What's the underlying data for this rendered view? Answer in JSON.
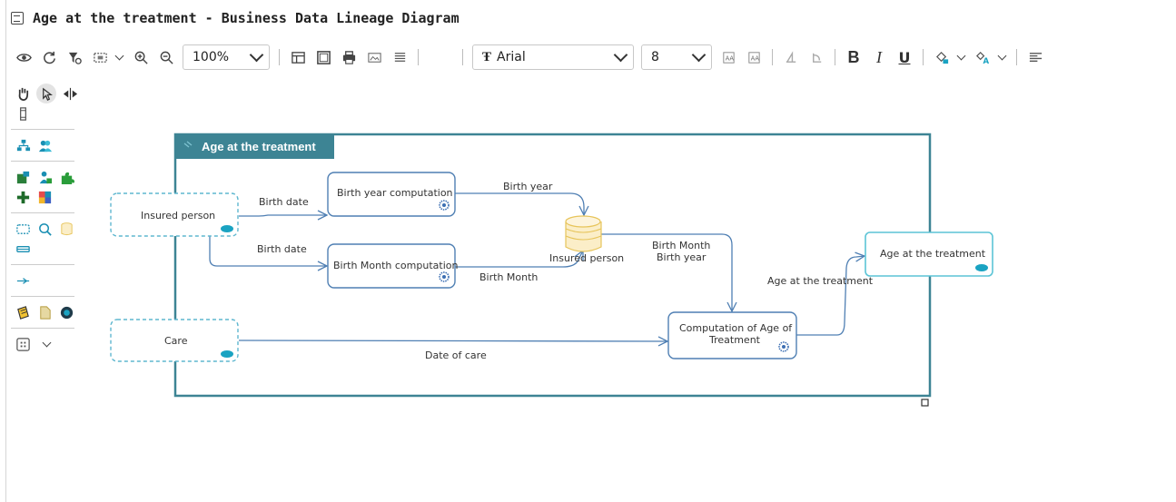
{
  "window": {
    "title": "Age at the treatment - Business Data Lineage Diagram"
  },
  "toolbar": {
    "zoom": "100%",
    "font_name": "Arial",
    "font_size": "8",
    "bold": "B",
    "italic": "I",
    "underline": "U",
    "icons": [
      "eye-icon",
      "refresh-icon",
      "filter-icon",
      "fit-icon",
      "zoom-in-icon",
      "zoom-out-icon",
      "layout-icon",
      "frame-icon",
      "print-icon",
      "image-icon",
      "list-icon",
      "font-icon",
      "text-style-icon",
      "rotate-left-icon",
      "rotate-right-icon",
      "fill-color-icon",
      "text-color-icon",
      "align-left-icon"
    ]
  },
  "palette": {
    "icons": [
      "hand-icon",
      "pointer-icon",
      "split-icon",
      "column-icon",
      "hierarchy-icon",
      "users-icon",
      "puzzle-map-icon",
      "puzzle-person-icon",
      "puzzle-icon",
      "puzzle-green-icon",
      "colored-grid-icon",
      "dashed-rect-icon",
      "search-zoom-icon",
      "database-icon",
      "bar-icon",
      "link-icon",
      "note-icon",
      "document-icon",
      "circle-icon",
      "grid-icon",
      "chevron-down-icon"
    ]
  },
  "diagram": {
    "container_title": "Age at the treatment",
    "nodes": {
      "insured_person": "Insured person",
      "care": "Care",
      "birth_year_computation": "Birth year computation",
      "birth_month_computation": "Birth Month computation",
      "insured_person_store": "Insured person",
      "computation_line1": "Computation of Age of",
      "computation_line2": "Treatment",
      "age_at_treatment": "Age at the treatment"
    },
    "edges": {
      "birth_date_1": "Birth date",
      "birth_date_2": "Birth date",
      "birth_year": "Birth year",
      "birth_month": "Birth Month",
      "birth_month_year_line1": "Birth Month",
      "birth_month_year_line2": "Birth year",
      "date_of_care": "Date of care",
      "age_at_the_treatment": "Age at the treatment"
    },
    "colors": {
      "container_border": "#3d8494",
      "title_bar": "#3d8494",
      "process_border": "#4f7fb3",
      "entity_dashed": "#5fb7cf",
      "output_border": "#5bc4d6",
      "store_fill": "#fbeec8",
      "store_stroke": "#e7c45a",
      "arrow": "#4f7fb3",
      "badge": "#1aa3c2"
    }
  }
}
